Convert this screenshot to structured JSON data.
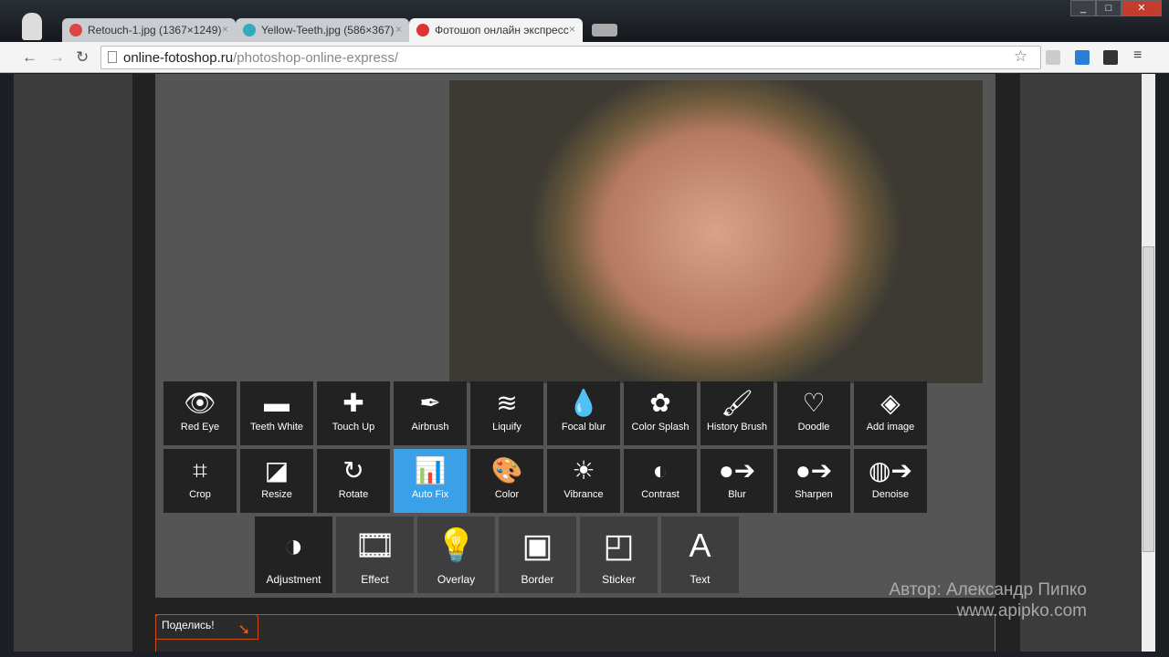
{
  "browser": {
    "tabs": [
      {
        "title": "Retouch-1.jpg (1367×1249)",
        "color": "#d44"
      },
      {
        "title": "Yellow-Teeth.jpg (586×367)",
        "color": "#3ab"
      },
      {
        "title": "Фотошоп онлайн экспресс",
        "color": "#d33",
        "active": true
      }
    ],
    "url_host": "online-fotoshop.ru",
    "url_path": "/photoshop-online-express/",
    "window_buttons": [
      "_",
      "□",
      "✕"
    ]
  },
  "editor": {
    "accent": "#3aa0e8",
    "row1": [
      {
        "label": "Red Eye",
        "icon": "eye-icon",
        "glyph": "👁"
      },
      {
        "label": "Teeth White",
        "icon": "toothbrush-icon",
        "glyph": "▬"
      },
      {
        "label": "Touch Up",
        "icon": "bandage-icon",
        "glyph": "✚"
      },
      {
        "label": "Airbrush",
        "icon": "airbrush-icon",
        "glyph": "✒"
      },
      {
        "label": "Liquify",
        "icon": "waves-icon",
        "glyph": "≋"
      },
      {
        "label": "Focal blur",
        "icon": "drops-icon",
        "glyph": "💧"
      },
      {
        "label": "Color Splash",
        "icon": "flower-icon",
        "glyph": "✿"
      },
      {
        "label": "History Brush",
        "icon": "brush-icon",
        "glyph": "🖌"
      },
      {
        "label": "Doodle",
        "icon": "doodle-icon",
        "glyph": "♡"
      },
      {
        "label": "Add image",
        "icon": "layers-icon",
        "glyph": "◈"
      }
    ],
    "row2": [
      {
        "label": "Crop",
        "icon": "crop-icon",
        "glyph": "⌗"
      },
      {
        "label": "Resize",
        "icon": "resize-icon",
        "glyph": "◪"
      },
      {
        "label": "Rotate",
        "icon": "rotate-icon",
        "glyph": "↻"
      },
      {
        "label": "Auto Fix",
        "icon": "auto-fix-icon",
        "glyph": "📊",
        "selected": true
      },
      {
        "label": "Color",
        "icon": "palette-icon",
        "glyph": "🎨"
      },
      {
        "label": "Vibrance",
        "icon": "sun-icon",
        "glyph": "☀"
      },
      {
        "label": "Contrast",
        "icon": "contrast-icon",
        "glyph": "◐"
      },
      {
        "label": "Blur",
        "icon": "blur-icon",
        "glyph": "●➔"
      },
      {
        "label": "Sharpen",
        "icon": "sharpen-icon",
        "glyph": "●➔"
      },
      {
        "label": "Denoise",
        "icon": "denoise-icon",
        "glyph": "◍➔"
      }
    ],
    "row3": [
      {
        "label": "Adjustment",
        "icon": "adjustment-icon",
        "glyph": "◑"
      },
      {
        "label": "Effect",
        "icon": "film-icon",
        "glyph": "🎞"
      },
      {
        "label": "Overlay",
        "icon": "bulb-icon",
        "glyph": "💡"
      },
      {
        "label": "Border",
        "icon": "border-icon",
        "glyph": "▣"
      },
      {
        "label": "Sticker",
        "icon": "sticker-icon",
        "glyph": "◰"
      },
      {
        "label": "Text",
        "icon": "text-icon",
        "glyph": "A"
      }
    ]
  },
  "share": {
    "label": "Поделись!"
  },
  "watermark": {
    "author": "Автор: Александр Пипко",
    "site": "www.apipko.com"
  }
}
